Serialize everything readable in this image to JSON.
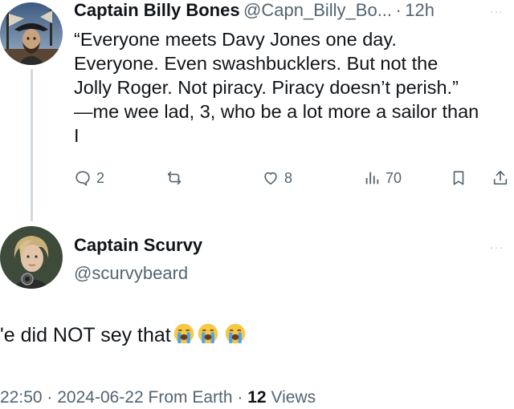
{
  "tweet": {
    "author_name": "Captain Billy Bones",
    "handle": "@Capn_Billy_Bo...",
    "separator": "·",
    "age": "12h",
    "more": "···",
    "text": "“Everyone meets Davy Jones one day.\nEveryone. Even swashbucklers. But not the\nJolly Roger. Not piracy. Piracy doesn’t perish.”\n—me wee lad, 3, who be a lot more a sailor than\nI",
    "stats": {
      "replies": "2",
      "likes": "8",
      "views": "70"
    }
  },
  "reply": {
    "author_name": "Captain Scurvy",
    "handle": "@scurvybeard",
    "more": "···",
    "text": "'e did NOT sey that",
    "emoji_count": 3,
    "time": "22:50",
    "date": "2024-06-22",
    "source": "From Earth",
    "views_count": "12",
    "views_label": "Views",
    "dot": "·"
  },
  "icons": {
    "reply": "comment-icon",
    "retweet": "retweet-icon",
    "like": "heart-icon",
    "views": "bar-chart-icon",
    "bookmark": "bookmark-icon",
    "share": "share-icon"
  },
  "colors": {
    "text": "#0f1419",
    "muted": "#536471",
    "thread_line": "#cfd9de"
  }
}
